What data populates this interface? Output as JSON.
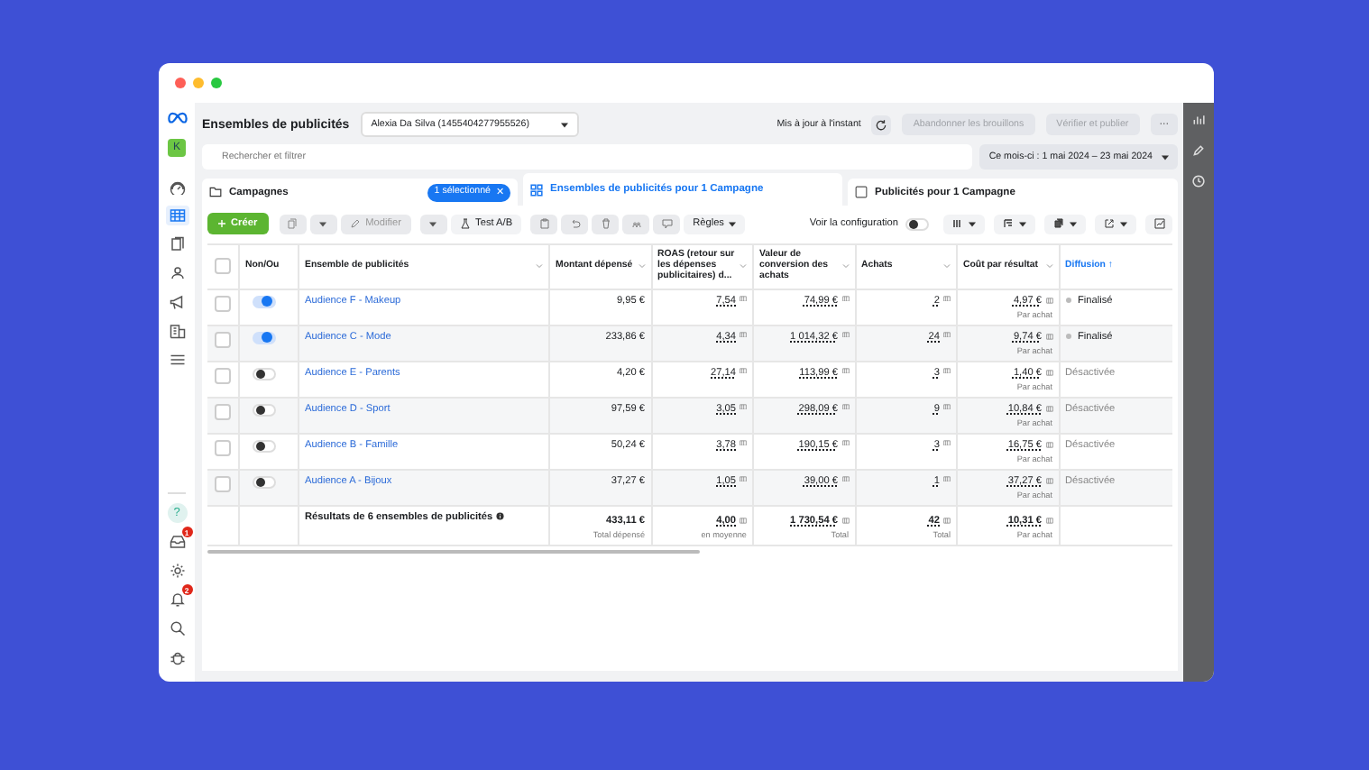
{
  "header": {
    "title": "Ensembles de publicités",
    "account": "Alexia Da Silva (1455404277955526)",
    "status": "Mis à jour à l'instant",
    "buttons": [
      {
        "label": "Abandonner les brouillons",
        "disabled": true
      },
      {
        "label": "Vérifier et publier",
        "disabled": true
      }
    ],
    "more": "···"
  },
  "search": {
    "placeholder": "Rechercher et filtrer"
  },
  "date_range": "Ce mois-ci : 1 mai 2024 – 23 mai 2024",
  "nav": {
    "avatar": "K",
    "items": [
      {
        "kind": "gauge",
        "selected": false
      },
      {
        "kind": "table",
        "selected": true
      },
      {
        "kind": "pages",
        "selected": false
      },
      {
        "kind": "people",
        "selected": false
      },
      {
        "kind": "megaphone",
        "selected": false
      },
      {
        "kind": "building",
        "selected": false
      },
      {
        "kind": "menu",
        "selected": false
      }
    ],
    "bottom": [
      {
        "kind": "help",
        "label": "?"
      },
      {
        "kind": "inbox",
        "badge": "1"
      },
      {
        "kind": "gear"
      },
      {
        "kind": "bell",
        "badge": "2"
      },
      {
        "kind": "search"
      },
      {
        "kind": "bug"
      }
    ]
  },
  "tabs": [
    {
      "label": "Campagnes",
      "selected": false,
      "kind": "folder",
      "badge": "1 sélectionné",
      "clear": "✕"
    },
    {
      "label": "Ensembles de publicités pour 1 Campagne",
      "selected": true,
      "kind": "grid"
    },
    {
      "label": "Publicités pour 1 Campagne",
      "selected": false,
      "kind": "square"
    }
  ],
  "toolbar": {
    "create": "Créer",
    "edit": {
      "label": "Modifier",
      "disabled": true
    },
    "ab_test": "Test A/B",
    "rules": "Règles",
    "config": {
      "label": "Voir la configuration",
      "on": false
    }
  },
  "select_all": {
    "checked": false
  },
  "columns": [
    {
      "label": "Non/Ou",
      "sorted": false
    },
    {
      "label": "Ensemble de publicités",
      "menu": true,
      "sorted": false
    },
    {
      "label": "Montant dépensé",
      "menu": true,
      "sorted": false
    },
    {
      "label": "ROAS (retour sur les dépenses publicitaires) d...",
      "menu": true,
      "sorted": false
    },
    {
      "label": "Valeur de conversion des achats",
      "menu": true,
      "sorted": false
    },
    {
      "label": "Achats",
      "menu": true,
      "sorted": false
    },
    {
      "label": "Coût par résultat",
      "menu": true,
      "sorted": false
    },
    {
      "label": "Diffusion ↑",
      "menu": false,
      "sorted": true
    }
  ],
  "rows": [
    {
      "checked": false,
      "on": true,
      "name": "Audience F - Makeup",
      "spent": "9,95 €",
      "roas": "7,54",
      "value": "74,99 €",
      "purchases": "2",
      "cost": "4,97 €",
      "cost_note": "Par achat",
      "delivery": "Finalisé",
      "delivery_disabled": false
    },
    {
      "checked": false,
      "on": true,
      "name": "Audience C - Mode",
      "spent": "233,86 €",
      "roas": "4,34",
      "value": "1 014,32 €",
      "purchases": "24",
      "cost": "9,74 €",
      "cost_note": "Par achat",
      "delivery": "Finalisé",
      "delivery_disabled": false
    },
    {
      "checked": false,
      "on": false,
      "name": "Audience E - Parents",
      "spent": "4,20 €",
      "roas": "27,14",
      "value": "113,99 €",
      "purchases": "3",
      "cost": "1,40 €",
      "cost_note": "Par achat",
      "delivery": "Désactivée",
      "delivery_disabled": true
    },
    {
      "checked": false,
      "on": false,
      "name": "Audience D - Sport",
      "spent": "97,59 €",
      "roas": "3,05",
      "value": "298,09 €",
      "purchases": "9",
      "cost": "10,84 €",
      "cost_note": "Par achat",
      "delivery": "Désactivée",
      "delivery_disabled": true
    },
    {
      "checked": false,
      "on": false,
      "name": "Audience B - Famille",
      "spent": "50,24 €",
      "roas": "3,78",
      "value": "190,15 €",
      "purchases": "3",
      "cost": "16,75 €",
      "cost_note": "Par achat",
      "delivery": "Désactivée",
      "delivery_disabled": true
    },
    {
      "checked": false,
      "on": false,
      "name": "Audience A - Bijoux",
      "spent": "37,27 €",
      "roas": "1,05",
      "value": "39,00 €",
      "purchases": "1",
      "cost": "37,27 €",
      "cost_note": "Par achat",
      "delivery": "Désactivée",
      "delivery_disabled": true
    }
  ],
  "totals": {
    "label": "Résultats de 6 ensembles de publicités",
    "spent": "433,11 €",
    "spent_note": "Total dépensé",
    "roas": "4,00",
    "roas_note": "en moyenne",
    "value": "1 730,54 €",
    "value_note": "Total",
    "purchases": "42",
    "purchases_note": "Total",
    "cost": "10,31 €",
    "cost_note": "Par achat"
  },
  "right_bar": [
    {
      "kind": "chart"
    },
    {
      "kind": "pencil"
    },
    {
      "kind": "clock"
    }
  ]
}
